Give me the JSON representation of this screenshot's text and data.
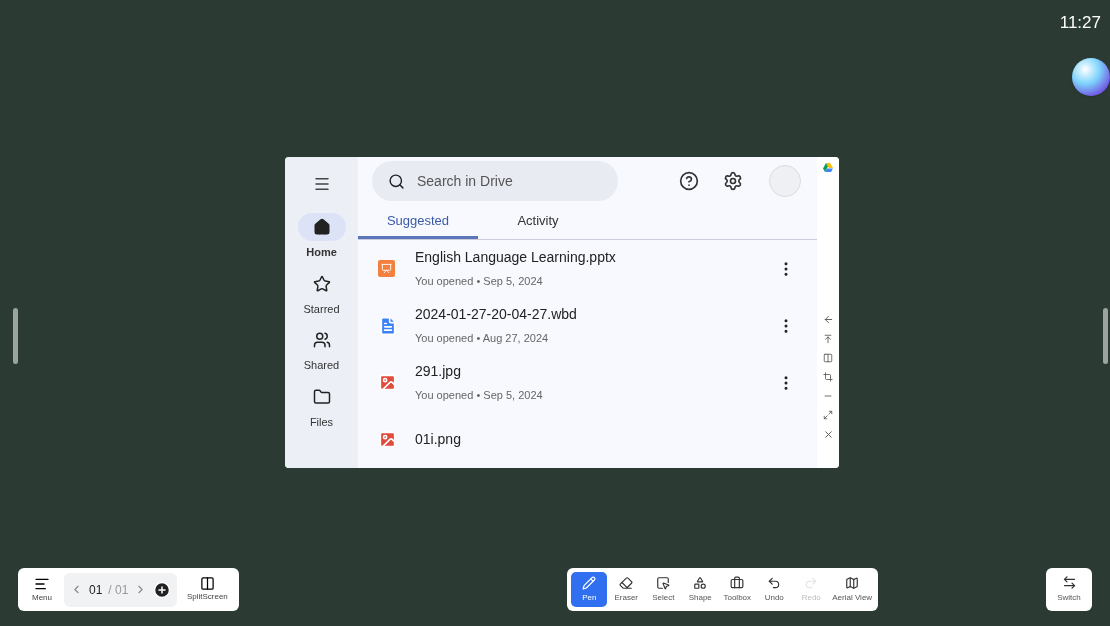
{
  "clock": "11:27",
  "drive": {
    "search": {
      "placeholder": "Search in Drive"
    },
    "nav": [
      {
        "label": "Home",
        "kind": "home",
        "selected": true
      },
      {
        "label": "Starred",
        "kind": "star",
        "selected": false
      },
      {
        "label": "Shared",
        "kind": "shared",
        "selected": false
      },
      {
        "label": "Files",
        "kind": "folder",
        "selected": false
      }
    ],
    "tabs": [
      {
        "label": "Suggested",
        "selected": true
      },
      {
        "label": "Activity",
        "selected": false
      }
    ],
    "files": [
      {
        "name": "English Language Learning.pptx",
        "kind": "slides",
        "detail": "You opened • Sep 5, 2024"
      },
      {
        "name": "2024-01-27-20-04-27.wbd",
        "kind": "doc",
        "detail": "You opened • Aug 27, 2024"
      },
      {
        "name": "291.jpg",
        "kind": "image",
        "detail": "You opened • Sep 5, 2024"
      },
      {
        "name": "01i.png",
        "kind": "image"
      }
    ]
  },
  "pager": {
    "current": "01",
    "total": "/ 01"
  },
  "left_tools": [
    {
      "label": "Menu",
      "kind": "menu"
    },
    {
      "label": "SplitScreen",
      "kind": "split"
    }
  ],
  "tools": [
    {
      "label": "Pen",
      "kind": "pen",
      "selected": true,
      "disabled": false
    },
    {
      "label": "Eraser",
      "kind": "eraser",
      "selected": false,
      "disabled": false
    },
    {
      "label": "Select",
      "kind": "select",
      "selected": false,
      "disabled": false
    },
    {
      "label": "Shape",
      "kind": "shape",
      "selected": false,
      "disabled": false
    },
    {
      "label": "Toolbox",
      "kind": "toolbox",
      "selected": false,
      "disabled": false
    },
    {
      "label": "Undo",
      "kind": "undo",
      "selected": false,
      "disabled": false
    },
    {
      "label": "Redo",
      "kind": "redo",
      "selected": false,
      "disabled": true
    },
    {
      "label": "Aerial View",
      "kind": "map",
      "selected": false,
      "disabled": false
    }
  ],
  "switch": {
    "label": "Switch"
  }
}
